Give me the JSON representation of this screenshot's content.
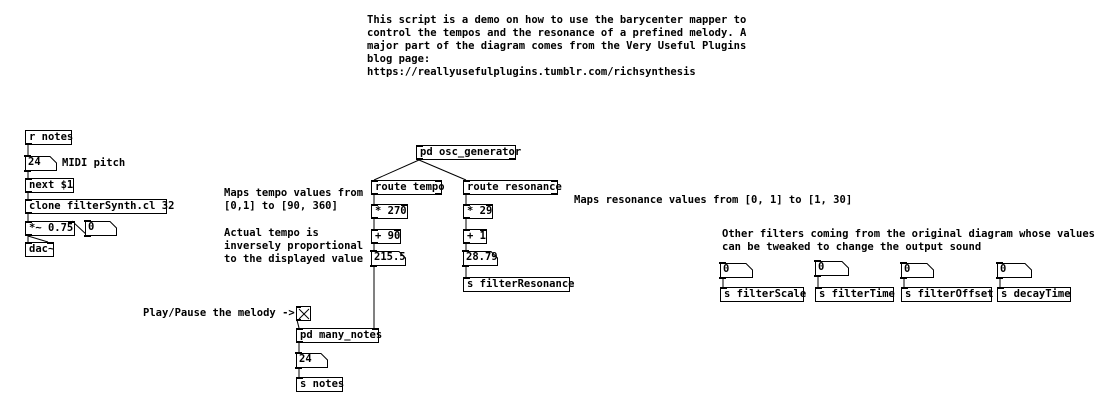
{
  "comments": {
    "intro": "This script is a demo on how to use the barycenter mapper to\ncontrol the tempos and the resonance of a prefined melody. A\nmajor part of the diagram comes from the Very Useful Plugins\nblog page:\nhttps://reallyusefulplugins.tumblr.com/richsynthesis",
    "midi_pitch": "MIDI pitch",
    "tempo_map": "Maps tempo values from\n[0,1] to [90, 360]",
    "actual_tempo": "Actual tempo is\ninversely proportional\nto the displayed value",
    "resonance_map": "Maps resonance values from [0, 1] to [1, 30]",
    "other_filters": "Other filters coming from the original diagram whose values\ncan be tweaked to change the output sound",
    "play_pause": "Play/Pause the melody ->"
  },
  "objects": {
    "r_notes": "r notes",
    "next": "next $1",
    "clone": "clone filterSynth.cl 32",
    "mult_075": "*~ 0.75",
    "dac": "dac~",
    "osc_generator": "pd osc_generator",
    "route_tempo": "route tempo",
    "route_resonance": "route resonance",
    "mult_270": "* 270",
    "plus_90": "+ 90",
    "mult_29": "* 29",
    "plus_1": "+ 1",
    "s_filterResonance": "s filterResonance",
    "many_notes": "pd many_notes",
    "s_notes": "s notes",
    "s_filterScale": "s filterScale",
    "s_filterTime": "s filterTime",
    "s_filterOffset": "s filterOffset",
    "s_decayTime": "s decayTime"
  },
  "numbers": {
    "midi_pitch_value": "24",
    "volume_value": "0",
    "tempo_value": "215.5",
    "resonance_value": "28.79",
    "notes_value": "24",
    "filterScale_value": "0",
    "filterTime_value": "0",
    "filterOffset_value": "0",
    "decayTime_value": "0"
  },
  "toggle": {
    "state": "on"
  }
}
